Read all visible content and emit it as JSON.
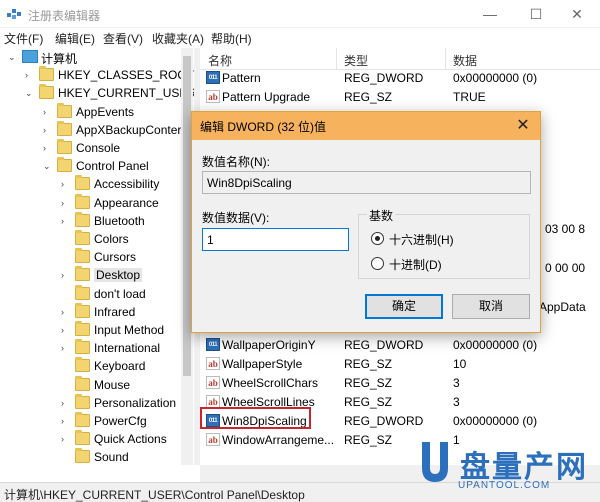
{
  "window": {
    "title": "注册表编辑器",
    "min_glyph": "—",
    "max_glyph": "☐",
    "close_glyph": "✕"
  },
  "menu": [
    "文件(F)",
    "编辑(E)",
    "查看(V)",
    "收藏夹(A)",
    "帮助(H)"
  ],
  "tree": [
    {
      "label": "计算机",
      "level": 0,
      "expanded": true,
      "icon": "computer-icon"
    },
    {
      "label": "HKEY_CLASSES_ROOT",
      "level": 1,
      "expanded": false,
      "icon": "folder-icon"
    },
    {
      "label": "HKEY_CURRENT_USER",
      "level": 1,
      "expanded": true,
      "icon": "folder-icon"
    },
    {
      "label": "AppEvents",
      "level": 2,
      "expanded": false,
      "icon": "folder-icon"
    },
    {
      "label": "AppXBackupConter",
      "level": 2,
      "expanded": false,
      "icon": "folder-icon"
    },
    {
      "label": "Console",
      "level": 2,
      "expanded": false,
      "icon": "folder-icon"
    },
    {
      "label": "Control Panel",
      "level": 2,
      "expanded": true,
      "icon": "folder-icon"
    },
    {
      "label": "Accessibility",
      "level": 3,
      "expanded": false,
      "icon": "folder-icon"
    },
    {
      "label": "Appearance",
      "level": 3,
      "expanded": false,
      "icon": "folder-icon"
    },
    {
      "label": "Bluetooth",
      "level": 3,
      "expanded": false,
      "icon": "folder-icon"
    },
    {
      "label": "Colors",
      "level": 3,
      "leaf": true,
      "icon": "folder-icon"
    },
    {
      "label": "Cursors",
      "level": 3,
      "leaf": true,
      "icon": "folder-icon"
    },
    {
      "label": "Desktop",
      "level": 3,
      "expanded": false,
      "selected": true,
      "icon": "folder-icon"
    },
    {
      "label": "don't load",
      "level": 3,
      "leaf": true,
      "icon": "folder-icon"
    },
    {
      "label": "Infrared",
      "level": 3,
      "expanded": false,
      "icon": "folder-icon"
    },
    {
      "label": "Input Method",
      "level": 3,
      "expanded": false,
      "icon": "folder-icon"
    },
    {
      "label": "International",
      "level": 3,
      "expanded": false,
      "icon": "folder-icon"
    },
    {
      "label": "Keyboard",
      "level": 3,
      "leaf": true,
      "icon": "folder-icon"
    },
    {
      "label": "Mouse",
      "level": 3,
      "leaf": true,
      "icon": "folder-icon"
    },
    {
      "label": "Personalization",
      "level": 3,
      "expanded": false,
      "icon": "folder-icon"
    },
    {
      "label": "PowerCfg",
      "level": 3,
      "expanded": false,
      "icon": "folder-icon"
    },
    {
      "label": "Quick Actions",
      "level": 3,
      "expanded": false,
      "icon": "folder-icon"
    },
    {
      "label": "Sound",
      "level": 3,
      "leaf": true,
      "icon": "folder-icon"
    }
  ],
  "list": {
    "columns": [
      "名称",
      "类型",
      "数据"
    ],
    "rows_top": [
      {
        "name": "Pattern",
        "type": "REG_DWORD",
        "data": "0x00000000 (0)",
        "icon": "dword-icon"
      },
      {
        "name": "Pattern Upgrade",
        "type": "REG_SZ",
        "data": "TRUE",
        "icon": "string-icon"
      }
    ],
    "partial_data": [
      "03 00 8",
      "0 00 00",
      "AppData"
    ],
    "rows_bottom": [
      {
        "name": "WallpaperOriginY",
        "type": "REG_DWORD",
        "data": "0x00000000 (0)",
        "icon": "dword-icon"
      },
      {
        "name": "WallpaperStyle",
        "type": "REG_SZ",
        "data": "10",
        "icon": "string-icon"
      },
      {
        "name": "WheelScrollChars",
        "type": "REG_SZ",
        "data": "3",
        "icon": "string-icon"
      },
      {
        "name": "WheelScrollLines",
        "type": "REG_SZ",
        "data": "3",
        "icon": "string-icon"
      },
      {
        "name": "Win8DpiScaling",
        "type": "REG_DWORD",
        "data": "0x00000000 (0)",
        "icon": "dword-icon",
        "highlighted": true
      },
      {
        "name": "WindowArrangeme...",
        "type": "REG_SZ",
        "data": "1",
        "icon": "string-icon"
      }
    ]
  },
  "dialog": {
    "title": "编辑 DWORD (32 位)值",
    "close_glyph": "✕",
    "name_label": "数值名称(N):",
    "name_value": "Win8DpiScaling",
    "data_label": "数值数据(V):",
    "data_value": "1",
    "base_label": "基数",
    "hex_label": "十六进制(H)",
    "dec_label": "十进制(D)",
    "selected_base": "hex",
    "ok_label": "确定",
    "cancel_label": "取消"
  },
  "status": {
    "path": "计算机\\HKEY_CURRENT_USER\\Control Panel\\Desktop"
  },
  "watermark": {
    "cn": "盘量产网",
    "en": "UPANTOOL.COM",
    "color": "#2c6fbd"
  },
  "colors": {
    "dialog_title_bg": "#f6b25c",
    "highlight_box": "#c8262e",
    "focus_blue": "#0078d7"
  }
}
